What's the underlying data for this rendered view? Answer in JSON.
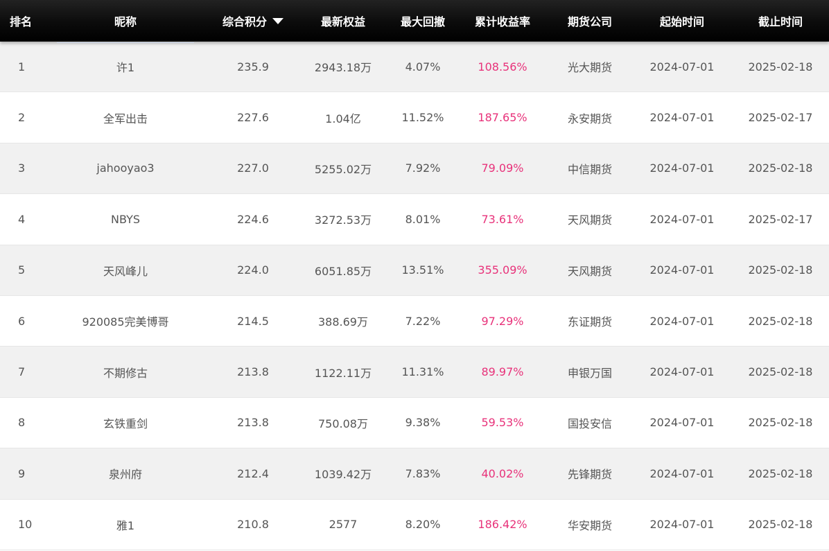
{
  "header": {
    "rank": "排名",
    "nickname": "昵称",
    "score": "综合积分",
    "equity": "最新权益",
    "drawdown": "最大回撤",
    "return": "累计收益率",
    "firm": "期货公司",
    "start": "起始时间",
    "end": "截止时间",
    "sort_icon": "caret-down-icon"
  },
  "colors": {
    "header_bg": "#000000",
    "header_text": "#ffffff",
    "row_alt": "#f1f1f1",
    "return_color": "#e8327a",
    "text": "#555555"
  },
  "rows": [
    {
      "rank": "1",
      "nickname": "许1",
      "score": "235.9",
      "equity": "2943.18万",
      "drawdown": "4.07%",
      "return": "108.56%",
      "firm": "光大期货",
      "start": "2024-07-01",
      "end": "2025-02-18"
    },
    {
      "rank": "2",
      "nickname": "全军出击",
      "score": "227.6",
      "equity": "1.04亿",
      "drawdown": "11.52%",
      "return": "187.65%",
      "firm": "永安期货",
      "start": "2024-07-01",
      "end": "2025-02-17"
    },
    {
      "rank": "3",
      "nickname": "jahooyao3",
      "score": "227.0",
      "equity": "5255.02万",
      "drawdown": "7.92%",
      "return": "79.09%",
      "firm": "中信期货",
      "start": "2024-07-01",
      "end": "2025-02-18"
    },
    {
      "rank": "4",
      "nickname": "NBYS",
      "score": "224.6",
      "equity": "3272.53万",
      "drawdown": "8.01%",
      "return": "73.61%",
      "firm": "天风期货",
      "start": "2024-07-01",
      "end": "2025-02-17"
    },
    {
      "rank": "5",
      "nickname": "天风峰儿",
      "score": "224.0",
      "equity": "6051.85万",
      "drawdown": "13.51%",
      "return": "355.09%",
      "firm": "天风期货",
      "start": "2024-07-01",
      "end": "2025-02-18"
    },
    {
      "rank": "6",
      "nickname": "920085完美博哥",
      "score": "214.5",
      "equity": "388.69万",
      "drawdown": "7.22%",
      "return": "97.29%",
      "firm": "东证期货",
      "start": "2024-07-01",
      "end": "2025-02-18"
    },
    {
      "rank": "7",
      "nickname": "不期修古",
      "score": "213.8",
      "equity": "1122.11万",
      "drawdown": "11.31%",
      "return": "89.97%",
      "firm": "申银万国",
      "start": "2024-07-01",
      "end": "2025-02-18"
    },
    {
      "rank": "8",
      "nickname": "玄铁重剑",
      "score": "213.8",
      "equity": "750.08万",
      "drawdown": "9.38%",
      "return": "59.53%",
      "firm": "国投安信",
      "start": "2024-07-01",
      "end": "2025-02-18"
    },
    {
      "rank": "9",
      "nickname": "泉州府",
      "score": "212.4",
      "equity": "1039.42万",
      "drawdown": "7.83%",
      "return": "40.02%",
      "firm": "先锋期货",
      "start": "2024-07-01",
      "end": "2025-02-18"
    },
    {
      "rank": "10",
      "nickname": "雅1",
      "score": "210.8",
      "equity": "2577",
      "drawdown": "8.20%",
      "return": "186.42%",
      "firm": "华安期货",
      "start": "2024-07-01",
      "end": "2025-02-18"
    }
  ]
}
